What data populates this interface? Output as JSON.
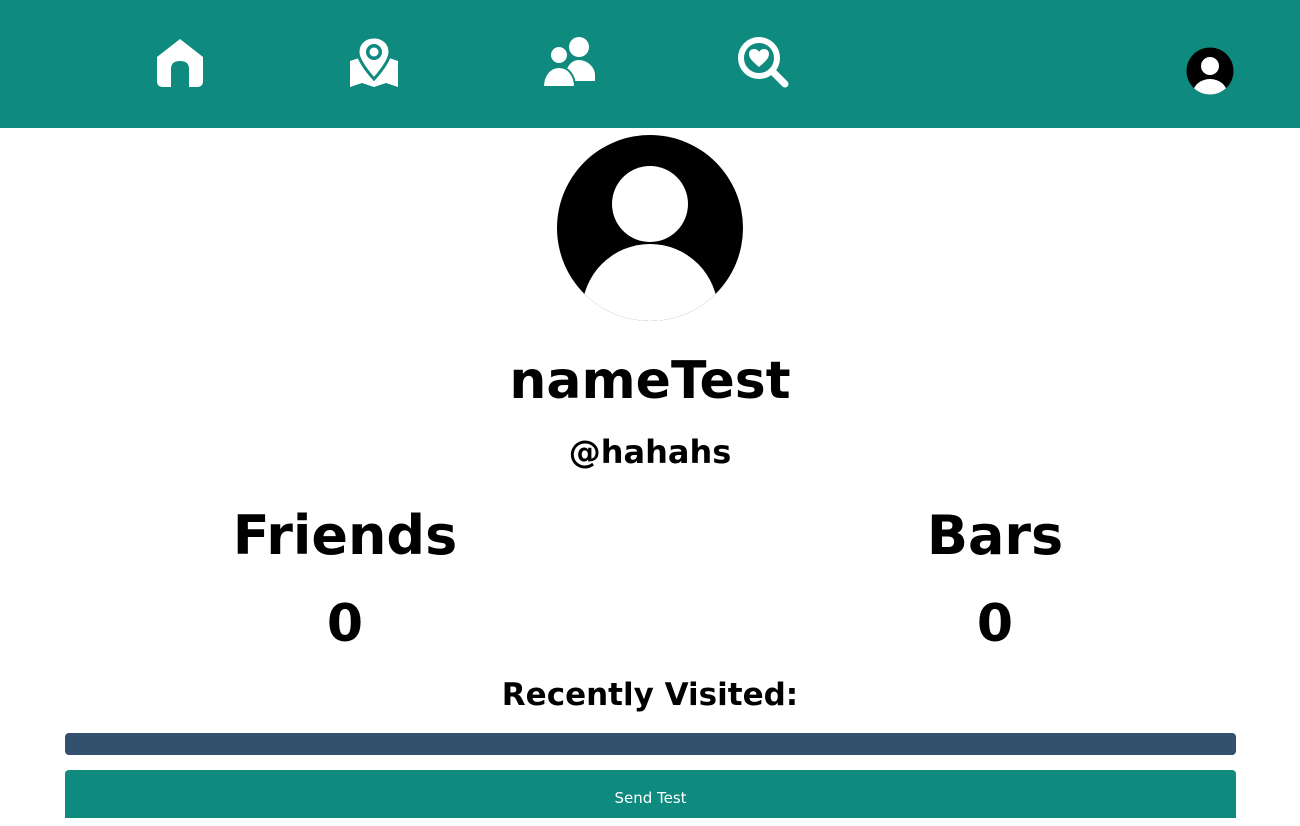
{
  "nav": {
    "items": [
      {
        "icon": "home-icon"
      },
      {
        "icon": "map-pin-icon"
      },
      {
        "icon": "friends-icon"
      },
      {
        "icon": "heart-search-icon"
      }
    ],
    "account_icon": "user-avatar-icon"
  },
  "colors": {
    "header_bg": "#0f8a7e",
    "recent_bar": "#34506f",
    "button_bg": "#0f8a7e"
  },
  "profile": {
    "avatar_icon": "user-avatar-icon",
    "display_name": "nameTest",
    "username": "@hahahs"
  },
  "stats": {
    "friends_label": "Friends",
    "friends_value": "0",
    "bars_label": "Bars",
    "bars_value": "0"
  },
  "recent": {
    "heading": "Recently Visited:"
  },
  "send_button": {
    "label": "Send Test"
  }
}
